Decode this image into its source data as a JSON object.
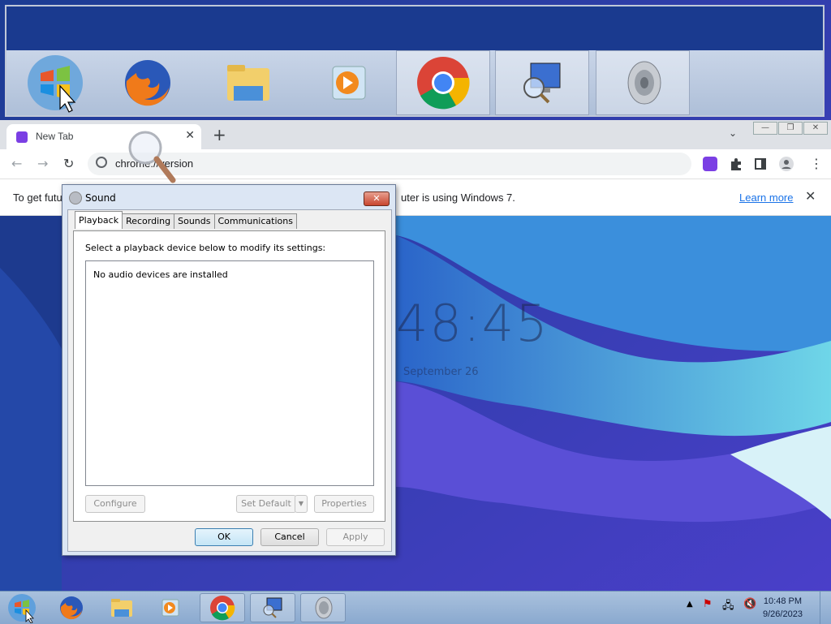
{
  "thumbnail_switcher": {
    "items": [
      {
        "name": "Start"
      },
      {
        "name": "Firefox"
      },
      {
        "name": "Windows Explorer"
      },
      {
        "name": "Windows Media Player"
      },
      {
        "name": "Google Chrome"
      },
      {
        "name": "Remote Desktop"
      },
      {
        "name": "Sound"
      }
    ]
  },
  "browser": {
    "tab_title": "New Tab",
    "url": "chrome://version",
    "infobar_message_left": "To get futu",
    "infobar_message_right": "uter is using Windows 7.",
    "learn_more": "Learn more"
  },
  "ntp": {
    "clock_text": "48:45",
    "date_text": "September 26"
  },
  "sound_dialog": {
    "title": "Sound",
    "tabs": [
      "Playback",
      "Recording",
      "Sounds",
      "Communications"
    ],
    "active_tab": "Playback",
    "instructions": "Select a playback device below to modify its settings:",
    "empty_list_text": "No audio devices are installed",
    "buttons": {
      "configure": "Configure",
      "set_default": "Set Default",
      "properties": "Properties",
      "ok": "OK",
      "cancel": "Cancel",
      "apply": "Apply"
    }
  },
  "taskbar": {
    "time": "10:48 PM",
    "date": "9/26/2023"
  },
  "colors": {
    "wallpaper_dark": "#1f3f95",
    "wallpaper_mid": "#2d6fd0",
    "wallpaper_light": "#6fd6e8",
    "taskbar": "#a9c1dd"
  }
}
